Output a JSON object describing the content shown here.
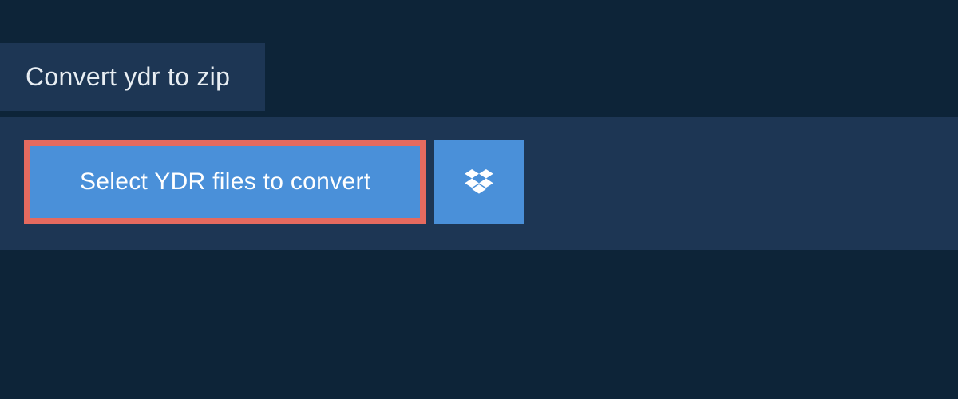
{
  "header": {
    "title": "Convert ydr to zip"
  },
  "actions": {
    "select_label": "Select YDR files to convert",
    "cloud_provider": "dropbox"
  },
  "colors": {
    "page_bg": "#0d2438",
    "panel_bg": "#1d3654",
    "button_bg": "#4a90d9",
    "highlight_border": "#e56a5f",
    "text_light": "#e8eef3"
  }
}
